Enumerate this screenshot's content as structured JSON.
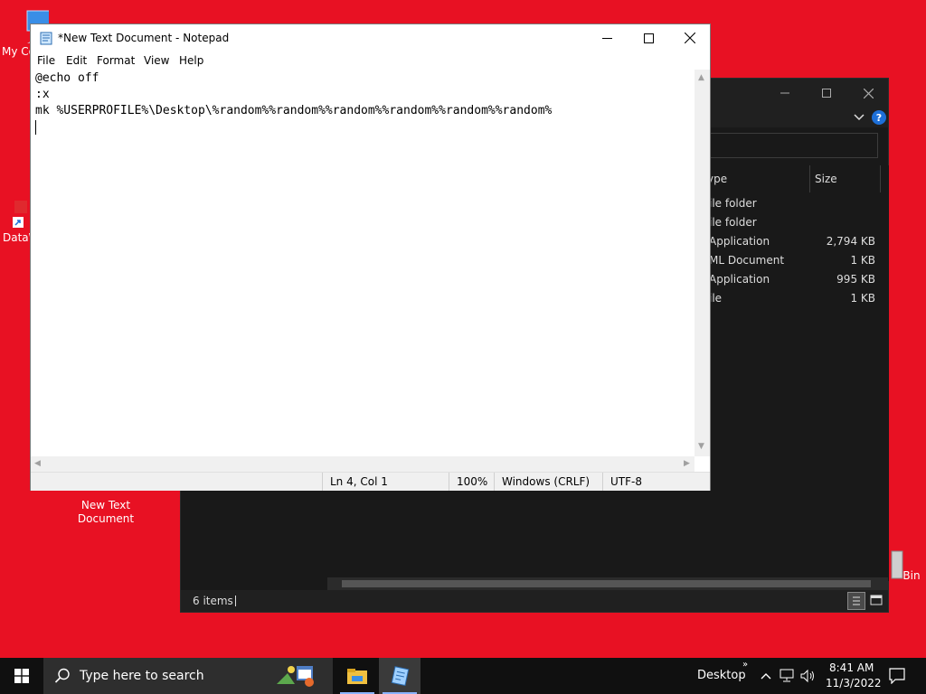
{
  "desktop": {
    "icons": [
      {
        "label": "My Co"
      },
      {
        "label": "DataW"
      },
      {
        "label": "New Text Document"
      },
      {
        "label": "Bin"
      }
    ]
  },
  "explorer": {
    "columns": {
      "type": "ype",
      "size": "Size"
    },
    "rows": [
      {
        "type": "ile folder",
        "size": ""
      },
      {
        "type": "ile folder",
        "size": ""
      },
      {
        "type": "Application",
        "size": "2,794 KB"
      },
      {
        "type": "ML Document",
        "size": "1 KB"
      },
      {
        "type": "Application",
        "size": "995 KB"
      },
      {
        "type": "ile",
        "size": "1 KB"
      }
    ],
    "status": {
      "items": "6 items"
    }
  },
  "notepad": {
    "title": "*New Text Document - Notepad",
    "menu": {
      "file": "File",
      "edit": "Edit",
      "format": "Format",
      "view": "View",
      "help": "Help"
    },
    "lines": [
      "@echo off",
      ":x",
      "mk %USERPROFILE%\\Desktop\\%random%%random%%random%%random%%random%%random%"
    ],
    "status": {
      "position": "Ln 4, Col 1",
      "zoom": "100%",
      "line_ending": "Windows (CRLF)",
      "encoding": "UTF-8"
    }
  },
  "taskbar": {
    "search_placeholder": "Type here to search",
    "desktop_label": "Desktop",
    "time": "8:41 AM",
    "date": "11/3/2022"
  },
  "colors": {
    "desktop_bg": "#e81123",
    "explorer_bg": "#191919",
    "taskbar_bg": "#101010"
  }
}
